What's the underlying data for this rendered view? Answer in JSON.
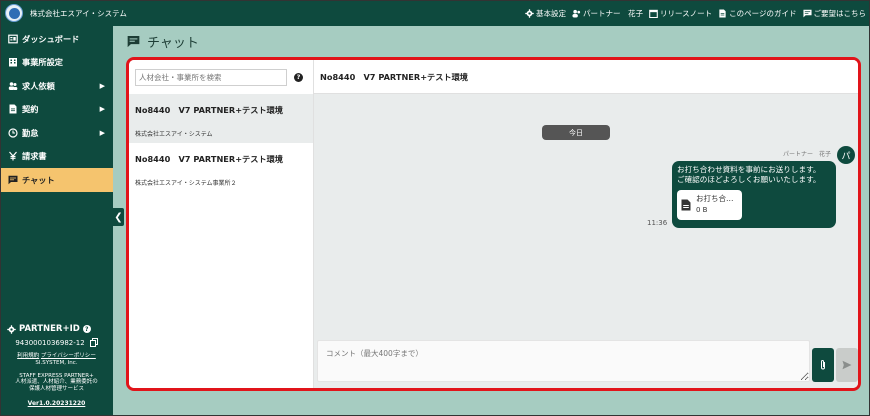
{
  "header": {
    "company": "株式会社エスアイ・システム",
    "nav": [
      {
        "label": "基本設定",
        "icon": "gear-icon"
      },
      {
        "label": "パートナー　花子",
        "icon": "users-icon"
      },
      {
        "label": "リリースノート",
        "icon": "calendar-icon"
      },
      {
        "label": "このページのガイド",
        "icon": "document-icon"
      },
      {
        "label": "ご要望はこちら",
        "icon": "comment-icon"
      }
    ]
  },
  "sidebar": {
    "items": [
      {
        "label": "ダッシュボード",
        "icon": "dashboard-icon",
        "has_arrow": false
      },
      {
        "label": "事業所設定",
        "icon": "building-icon",
        "has_arrow": false
      },
      {
        "label": "求人依頼",
        "icon": "people-icon",
        "has_arrow": true
      },
      {
        "label": "契約",
        "icon": "contract-icon",
        "has_arrow": true
      },
      {
        "label": "勤怠",
        "icon": "clock-icon",
        "has_arrow": true
      },
      {
        "label": "請求書",
        "icon": "yen-icon",
        "has_arrow": false
      },
      {
        "label": "チャット",
        "icon": "chat-icon",
        "has_arrow": false,
        "active": true
      }
    ],
    "arrow": "▶",
    "collapse_glyph": "❮",
    "partner_id_label": "PARTNER+ID",
    "partner_id_number": "9430001036982-12",
    "links_line1": "利用規約",
    "links_sep": " ",
    "links_line1b": "プライバシーポリシー",
    "links_line2": "SI.SYSTEM, Inc.",
    "product_line1": "STAFF EXPRESS PARTNER+",
    "product_line2": "人材派遣、人材紹介、業務委託の",
    "product_line3": "保護人材管理サービス",
    "version": "Ver1.0.20231220"
  },
  "page": {
    "title": "チャット"
  },
  "chat": {
    "search_placeholder": "人材会社・事業所を検索",
    "help_glyph": "?",
    "conversations": [
      {
        "title": "No8440　V7 PARTNER+テスト環境",
        "subtitle": "株式会社エスアイ・システム",
        "selected": true
      },
      {
        "title": "No8440　V7 PARTNER+テスト環境",
        "subtitle": "株式会社エスアイ・システム事業所２",
        "selected": false
      }
    ],
    "header_title": "No8440　V7 PARTNER+テスト環境",
    "date_chip": "今日",
    "message": {
      "sender": "パートナー　花子",
      "avatar_initial": "パ",
      "line1": "お打ち合わせ資料を事前にお送りします。",
      "line2": "ご確認のほどよろしくお願いいたします。",
      "attachment_name": "お打ち合…",
      "attachment_size": "0 B",
      "time": "11:36"
    },
    "composer_placeholder": "コメント（最大400字まで）"
  },
  "colors": {
    "brand": "#0e4a3e",
    "active_nav": "#f5c46e",
    "highlight_border": "#e1141a",
    "background": "#a6ccc1"
  }
}
